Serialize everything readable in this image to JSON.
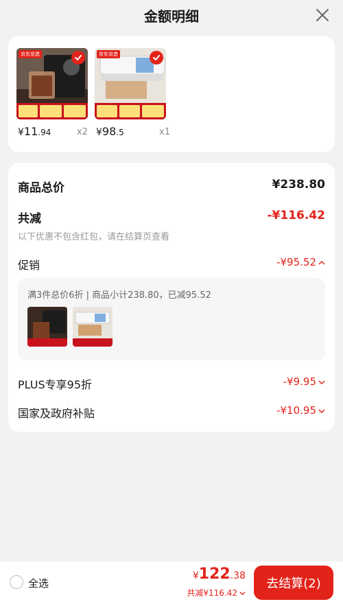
{
  "header": {
    "title": "金额明细"
  },
  "products": [
    {
      "store_tag": "京东京造",
      "price_yen": "¥",
      "price_int": "11",
      "price_dec": ".94",
      "qty": "x2"
    },
    {
      "store_tag": "京东京造",
      "price_yen": "¥",
      "price_int": "98",
      "price_dec": ".5",
      "qty": "x1"
    }
  ],
  "summary": {
    "goods_total_label": "商品总价",
    "goods_total_value": "¥238.80",
    "total_discount_label": "共减",
    "total_discount_value": "-¥116.42",
    "note": "以下优惠不包含红包，请在结算页查看"
  },
  "promotion": {
    "label": "促销",
    "value": "-¥95.52",
    "description": "满3件总价6折 | 商品小计238.80，已减95.52"
  },
  "plus": {
    "label": "PLUS专享95折",
    "value": "-¥9.95"
  },
  "subsidy": {
    "label": "国家及政府补贴",
    "value": "-¥10.95"
  },
  "bottom_bar": {
    "select_all_label": "全选",
    "total_yen": "¥",
    "total_int": "122",
    "total_dec": ".38",
    "saved_text": "共减¥116.42",
    "checkout_label": "去结算(2)"
  },
  "colors": {
    "accent_red": "#e2231a",
    "background": "#f2f2f2",
    "card": "#ffffff"
  }
}
